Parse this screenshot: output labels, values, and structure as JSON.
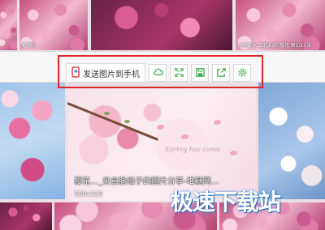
{
  "grid": {
    "top_tiles": [
      {
        "caption": "美丽的  "
      },
      {
        "caption": ""
      },
      {
        "caption": "小桥流水 红花灿烂 樱花 第1/11张"
      }
    ]
  },
  "toolbar": {
    "send_to_phone_label": "发送图片到手机",
    "icons": [
      "cloud-upload-icon",
      "fullscreen-icon",
      "save-icon",
      "share-icon",
      "settings-icon"
    ]
  },
  "feature": {
    "script_text": "Spring has come",
    "caption": "樱花…_来自脉络子的图片分享-堆糖网…",
    "size": "500x329"
  },
  "watermark": {
    "text": "极速下载站"
  }
}
